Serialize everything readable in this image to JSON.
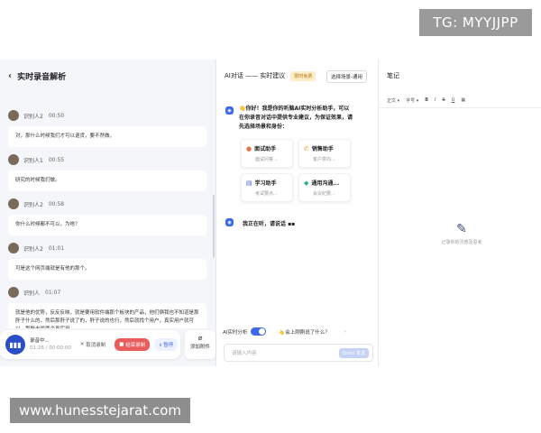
{
  "watermarks": {
    "top": "TG: MYYJJPP",
    "bottom": "www.hunesstejarat.com"
  },
  "left": {
    "title": "实时录音解析",
    "messages": [
      {
        "speaker": "识别人2",
        "time": "00:50",
        "text": "对，那什么时候我们才可以退货，要不然做。"
      },
      {
        "speaker": "识别人1",
        "time": "00:55",
        "text": "研究的时候我们做。"
      },
      {
        "speaker": "识别人2",
        "time": "00:58",
        "text": "你什么时候都不可以，为啥？"
      },
      {
        "speaker": "识别人2",
        "time": "01:01",
        "text": "可是这个网页端就是有他的那个。"
      },
      {
        "speaker": "识别人",
        "time": "01:07",
        "text": "就是他的优势，反反反映，就是要用软件端那个板块的产品，他们俩我也不知道是那肝子什么的，然后那肝子说了的，肝子说的也行，然后就找个用户，真实用户就可以，那既去找两个真实用"
      }
    ],
    "recording": {
      "status": "录音中...",
      "time": "01:26 / 00:00:00",
      "cancel": "取消录制",
      "end": "结束录制",
      "pause": "暂停"
    },
    "attach": "添加附件"
  },
  "mid": {
    "title": "AI对话 —— 实时建议",
    "badge": "限时免费",
    "scene_button": "选择场景-通用",
    "greeting": "👋你好！我是你的听脑AI实时分析助手，可以在你录音对话中提供专业建议，为保证效果，请先选择场景和身份：",
    "cards": [
      {
        "icon": "👤",
        "title": "面试助手",
        "desc": "面试问答..."
      },
      {
        "icon": "📞",
        "title": "销售助手",
        "desc": "客户意向..."
      },
      {
        "icon": "📖",
        "title": "学习助手",
        "desc": "考试要点..."
      },
      {
        "icon": "💬",
        "title": "通用沟通...",
        "desc": "会议纪要..."
      }
    ],
    "listening": "我正在听，请说话 ▪▪",
    "realtime_label": "AI实时分析",
    "suggest": "👆会上刚刚说了什么？",
    "input_placeholder": "请输入内容",
    "send": "Enter 发送"
  },
  "right": {
    "title": "笔记",
    "toolbar": [
      "正文 ▾",
      "字号 ▾",
      "B",
      "I",
      "S",
      "U",
      "▦"
    ],
    "empty_text": "记录你的灵感及思考"
  },
  "colors": {
    "accent": "#3d68e8",
    "end_red": "#ea5b5b",
    "badge_bg": "#fdecc8"
  }
}
